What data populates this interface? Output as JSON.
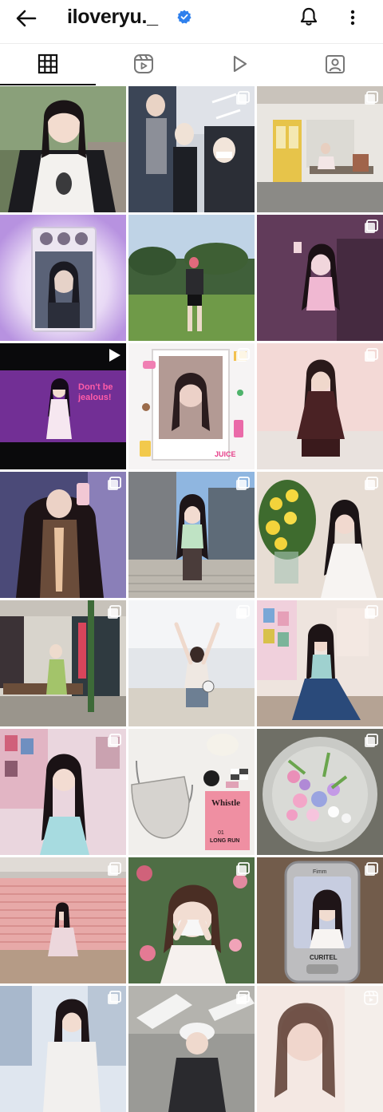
{
  "header": {
    "username": "iloveryu._"
  },
  "icons": [
    "back-arrow-icon",
    "verified-badge-icon",
    "bell-icon",
    "more-options-icon",
    "grid-icon",
    "reels-icon",
    "play-icon",
    "tagged-icon"
  ],
  "colors": {
    "verified": "#2f80ed",
    "active_tab": "#111111"
  },
  "tabs": [
    {
      "name": "posts-grid",
      "active": true
    },
    {
      "name": "reels",
      "active": false
    },
    {
      "name": "videos",
      "active": false
    },
    {
      "name": "tagged",
      "active": false
    }
  ],
  "posts": {
    "row1": [
      "selfie white shirt",
      "friends masked group",
      "yellow door street"
    ],
    "row2": [
      "photocard purple",
      "park green field",
      "pink light pose"
    ],
    "row3": [
      "video stage purple",
      "polaroid stickers",
      "bedroom pose"
    ],
    "row4": [
      "mirror selfie",
      "building stairs",
      "yellow flowers"
    ],
    "row5": [
      "green dress bench",
      "beach arms up",
      "room wall photos"
    ],
    "row6": [
      "portrait blue top",
      "bag and objects",
      "flowers in bowl"
    ],
    "row7": [
      "pink shutter squat",
      "masked braid",
      "retro phone"
    ],
    "row8": [
      "window portrait",
      "cap outdoor",
      "blurred portrait"
    ]
  },
  "polaroid_text": {
    "sticker": "JUICE"
  },
  "video_overlay": {
    "caption1": "Don't be",
    "caption2": "jealous!"
  },
  "book": {
    "title": "Whistle",
    "sub1": "01",
    "sub2": "LONG RUN"
  },
  "phone": {
    "brand": "CURITEL",
    "top": "Fimm"
  }
}
